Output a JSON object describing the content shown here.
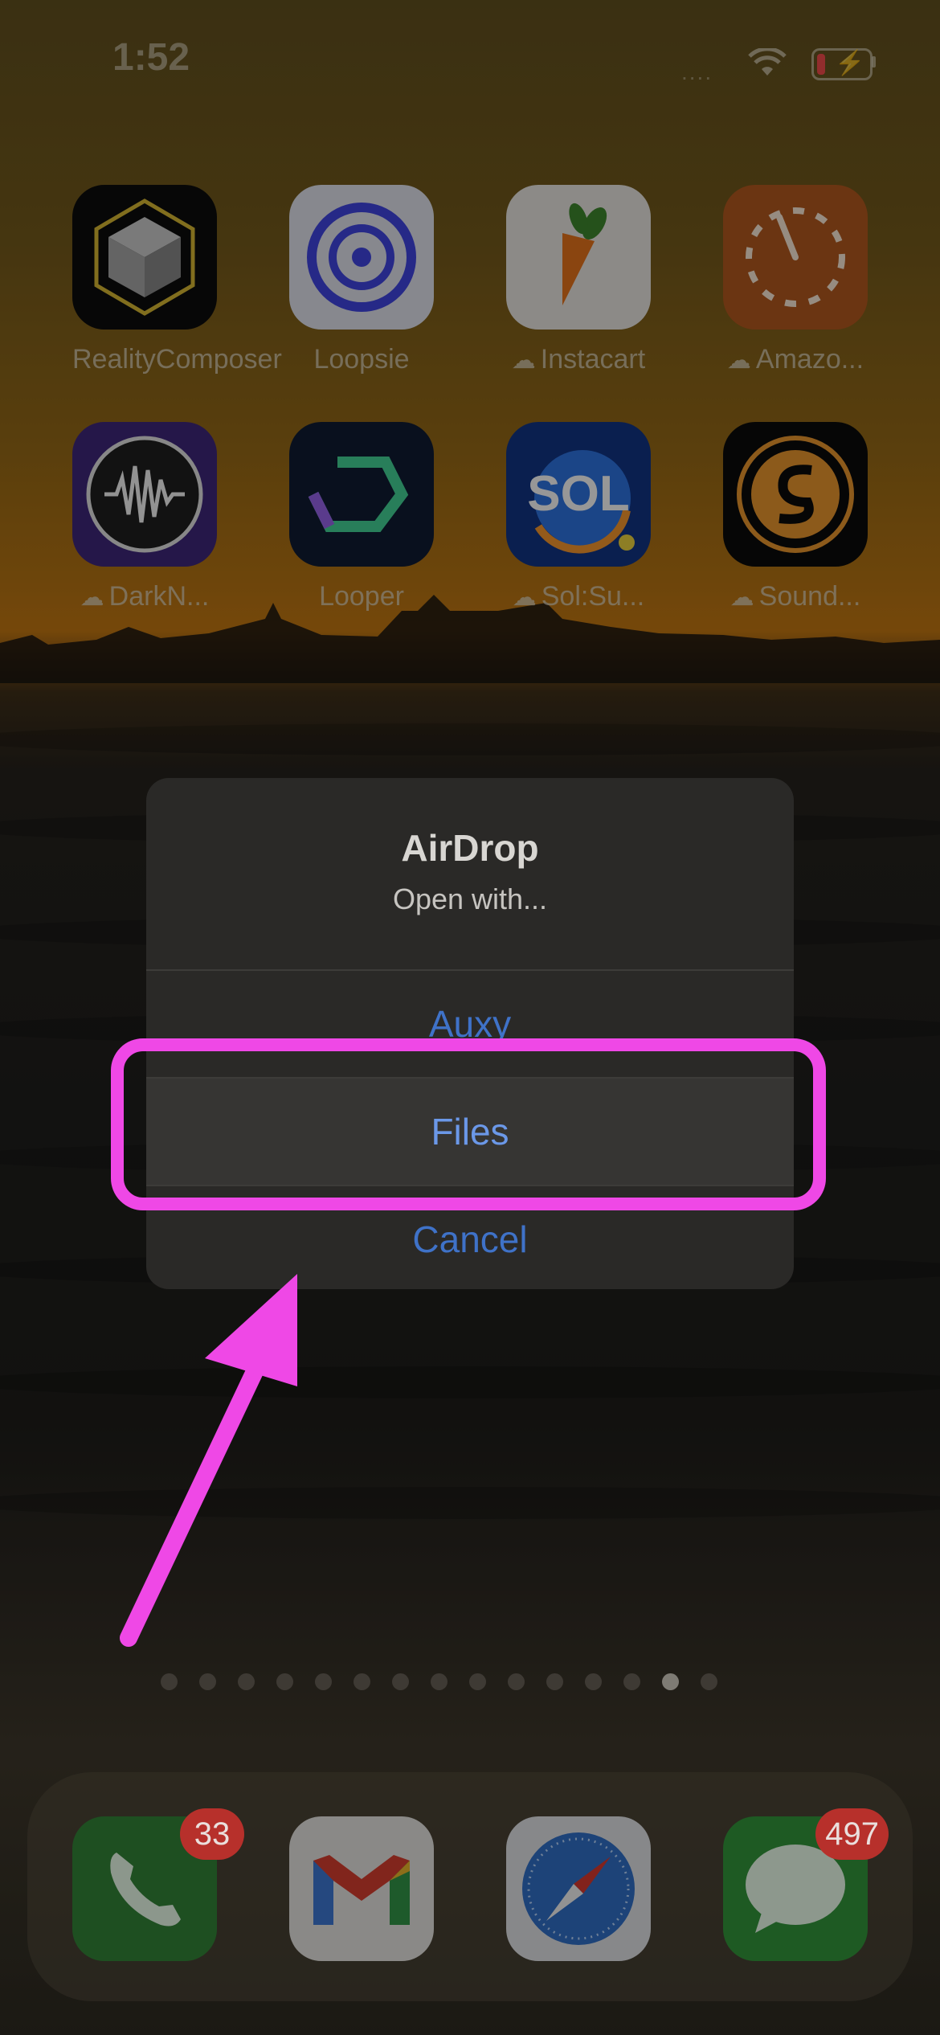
{
  "status_bar": {
    "time": "1:52",
    "signal": "....",
    "battery_color": "#e04646"
  },
  "home_apps": [
    {
      "name": "RealityComposer",
      "cloud": false
    },
    {
      "name": "Loopsie",
      "cloud": false
    },
    {
      "name": "Instacart",
      "cloud": true
    },
    {
      "name": "Amazo...",
      "cloud": true
    },
    {
      "name": "DarkN...",
      "cloud": true
    },
    {
      "name": "Looper",
      "cloud": false
    },
    {
      "name": "Sol:Su...",
      "cloud": true
    },
    {
      "name": "Sound...",
      "cloud": true
    }
  ],
  "icon_text": {
    "sol": "SOL"
  },
  "page_dots": {
    "count": 15,
    "active_index": 13
  },
  "dock": {
    "phone_badge": "33",
    "messages_badge": "497"
  },
  "dialog": {
    "title": "AirDrop",
    "subtitle": "Open with...",
    "option_auxy": "Auxy",
    "option_files": "Files",
    "cancel": "Cancel"
  },
  "annotation": {
    "highlight_color": "#ef48e6"
  }
}
